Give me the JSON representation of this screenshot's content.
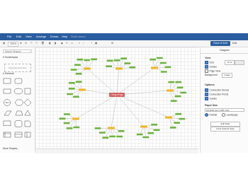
{
  "menubar": {
    "items": [
      "File",
      "Edit",
      "View",
      "Arrange",
      "Extras",
      "Help"
    ],
    "status": "Draft saved"
  },
  "toolbar": {
    "zoom": "100%",
    "save_exit": "Save & Exit",
    "exit": "Exit"
  },
  "sidebar": {
    "search_placeholder": "Search Shapes",
    "scratchpad_title": "Scratchpad",
    "scratchpad_hint": "Drag elements here",
    "general_title": "General",
    "more_shapes": "More Shapes..."
  },
  "format_panel": {
    "tab": "Diagram",
    "view_header": "View",
    "grid_label": "Grid",
    "grid_size": "10 pt",
    "guides_label": "Guides",
    "page_view_label": "Page View",
    "background_label": "Background",
    "image_button": "Image",
    "options_header": "Options",
    "connection_arrows": "Connection Arrows",
    "connection_points": "Connection Points",
    "guides_option": "Guides",
    "paper_size_header": "Paper Size",
    "paper_size_value": "A4 (210 mm x 297 mm)",
    "portrait": "Portrait",
    "landscape": "Landscape",
    "edit_data": "Edit Data",
    "clear_default_style": "Clear Default Style"
  },
  "diagram": {
    "central_label": "Living things",
    "colors": {
      "central": "#cf5555",
      "secondary": "#f0b429",
      "leaf": "#6cb33f",
      "edge": "#999999",
      "accent": "#2a5d9f"
    }
  }
}
